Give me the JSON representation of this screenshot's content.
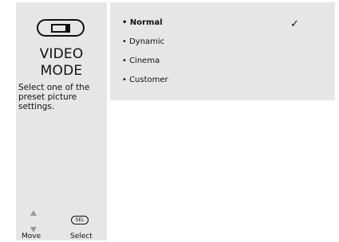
{
  "sidebar": {
    "icon": "tv-icon",
    "title_line1": "VIDEO",
    "title_line2": "MODE",
    "description": "Select one of the preset picture settings.",
    "hint_move": "Move",
    "hint_select": "Select",
    "sel_key_label": "SEL"
  },
  "menu": {
    "items": [
      {
        "label": "• Normal",
        "selected": true
      },
      {
        "label": "• Dynamic",
        "selected": false
      },
      {
        "label": "• Cinema",
        "selected": false
      },
      {
        "label": "• Customer",
        "selected": false
      }
    ],
    "check_icon": "checkmark-icon",
    "check_glyph": "✓"
  }
}
